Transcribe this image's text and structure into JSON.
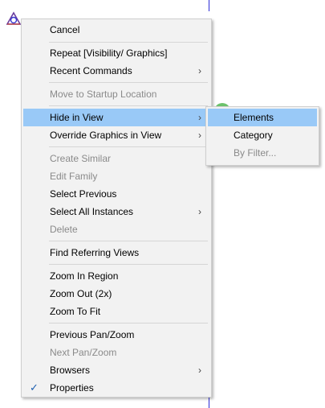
{
  "colors": {
    "highlight": "#99c9f7",
    "disabled": "#8a8a8a",
    "menu_bg": "#f2f2f2",
    "check": "#1e5fb0"
  },
  "context_menu": {
    "items": [
      {
        "label": "Cancel"
      },
      {
        "label": "Repeat [Visibility/ Graphics]"
      },
      {
        "label": "Recent Commands",
        "submenu_icon": "chevron-right-icon"
      },
      {
        "label": "Move to Startup Location",
        "disabled": true
      },
      {
        "label": "Hide in View",
        "highlighted": true,
        "submenu_icon": "chevron-right-icon"
      },
      {
        "label": "Override Graphics in View",
        "submenu_icon": "chevron-right-icon"
      },
      {
        "label": "Create Similar",
        "disabled": true
      },
      {
        "label": "Edit Family",
        "disabled": true
      },
      {
        "label": "Select Previous"
      },
      {
        "label": "Select All Instances",
        "submenu_icon": "chevron-right-icon"
      },
      {
        "label": "Delete",
        "disabled": true
      },
      {
        "label": "Find Referring Views"
      },
      {
        "label": "Zoom In Region"
      },
      {
        "label": "Zoom Out (2x)"
      },
      {
        "label": "Zoom To Fit"
      },
      {
        "label": "Previous Pan/Zoom"
      },
      {
        "label": "Next Pan/Zoom",
        "disabled": true
      },
      {
        "label": "Browsers",
        "submenu_icon": "chevron-right-icon"
      },
      {
        "label": "Properties",
        "checked": true,
        "check_icon": "checkmark-icon"
      }
    ]
  },
  "submenu": {
    "items": [
      {
        "label": "Elements",
        "highlighted": true
      },
      {
        "label": "Category"
      },
      {
        "label": "By Filter...",
        "disabled": true
      }
    ]
  },
  "glyphs": {
    "arrow": "›",
    "check": "✓"
  }
}
